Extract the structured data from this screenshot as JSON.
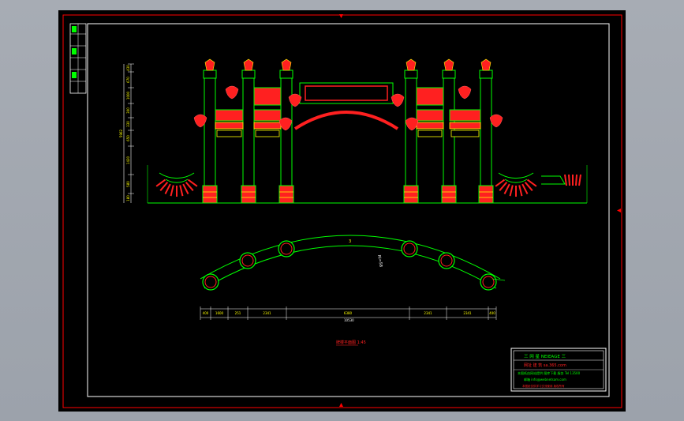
{
  "drawing": {
    "elevation_dims_left": [
      "430",
      "670",
      "1000",
      "300",
      "330",
      "650",
      "1420",
      "580",
      "180"
    ],
    "elevation_total": "5962",
    "plan_label_top": "3",
    "plan_label_side": "RI=58",
    "plan_dims_top": [
      "400",
      "1600",
      "251",
      "2341",
      "6380",
      "2341",
      "2341",
      "400"
    ],
    "plan_dims_bottom": "10530",
    "caption": "牌楼平面图 1:45"
  },
  "title_block": {
    "line1": "三 网 星  NEIEAGE 三",
    "line2": "网址 建 筑    sa.365.com",
    "line3": "本图纸由网站提供 图库下载 服务 Tel 13500",
    "line4": "邮箱 info@webnetsam.com",
    "line5": "本图纸仅供学习交流使用 版权所有"
  },
  "colors": {
    "frame": "#ff0000",
    "border": "#ffffff",
    "structure": "#00ff00",
    "ornament": "#ff2020",
    "accent": "#ffff00"
  }
}
